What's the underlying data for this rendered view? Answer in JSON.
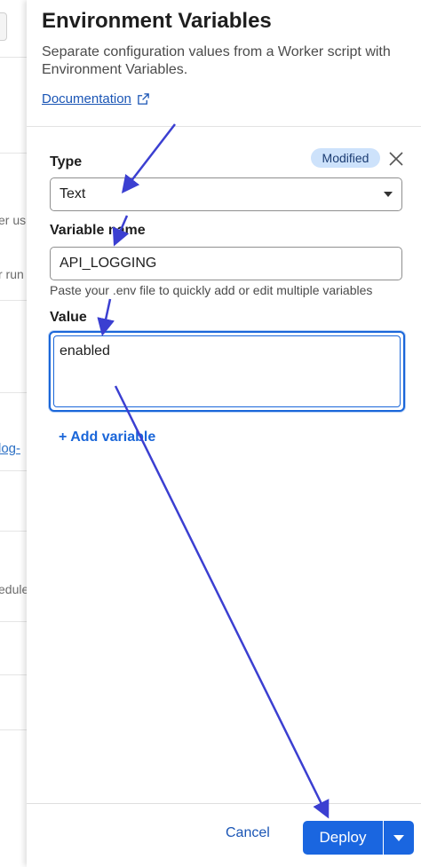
{
  "background": {
    "fragments": [
      {
        "text": "er us",
        "style": "text"
      },
      {
        "text": "r run",
        "style": "text"
      },
      {
        "text": "log-",
        "style": "link"
      },
      {
        "text": "edule",
        "style": "text"
      }
    ]
  },
  "panel": {
    "title": "Environment Variables",
    "subtitle": "Separate configuration values from a Worker script with Environment Variables.",
    "documentation_label": "Documentation"
  },
  "form": {
    "modified_badge": "Modified",
    "type_label": "Type",
    "type_value": "Text",
    "name_label": "Variable name",
    "name_value": "API_LOGGING",
    "hint": "Paste your .env file to quickly add or edit multiple variables",
    "value_label": "Value",
    "value_value": "enabled",
    "add_variable": "+ Add variable"
  },
  "footer": {
    "cancel_label": "Cancel",
    "deploy_label": "Deploy"
  },
  "colors": {
    "accent": "#1a66e0",
    "annotation_arrow": "#3b3fd1",
    "badge_bg": "#cde2fb"
  }
}
